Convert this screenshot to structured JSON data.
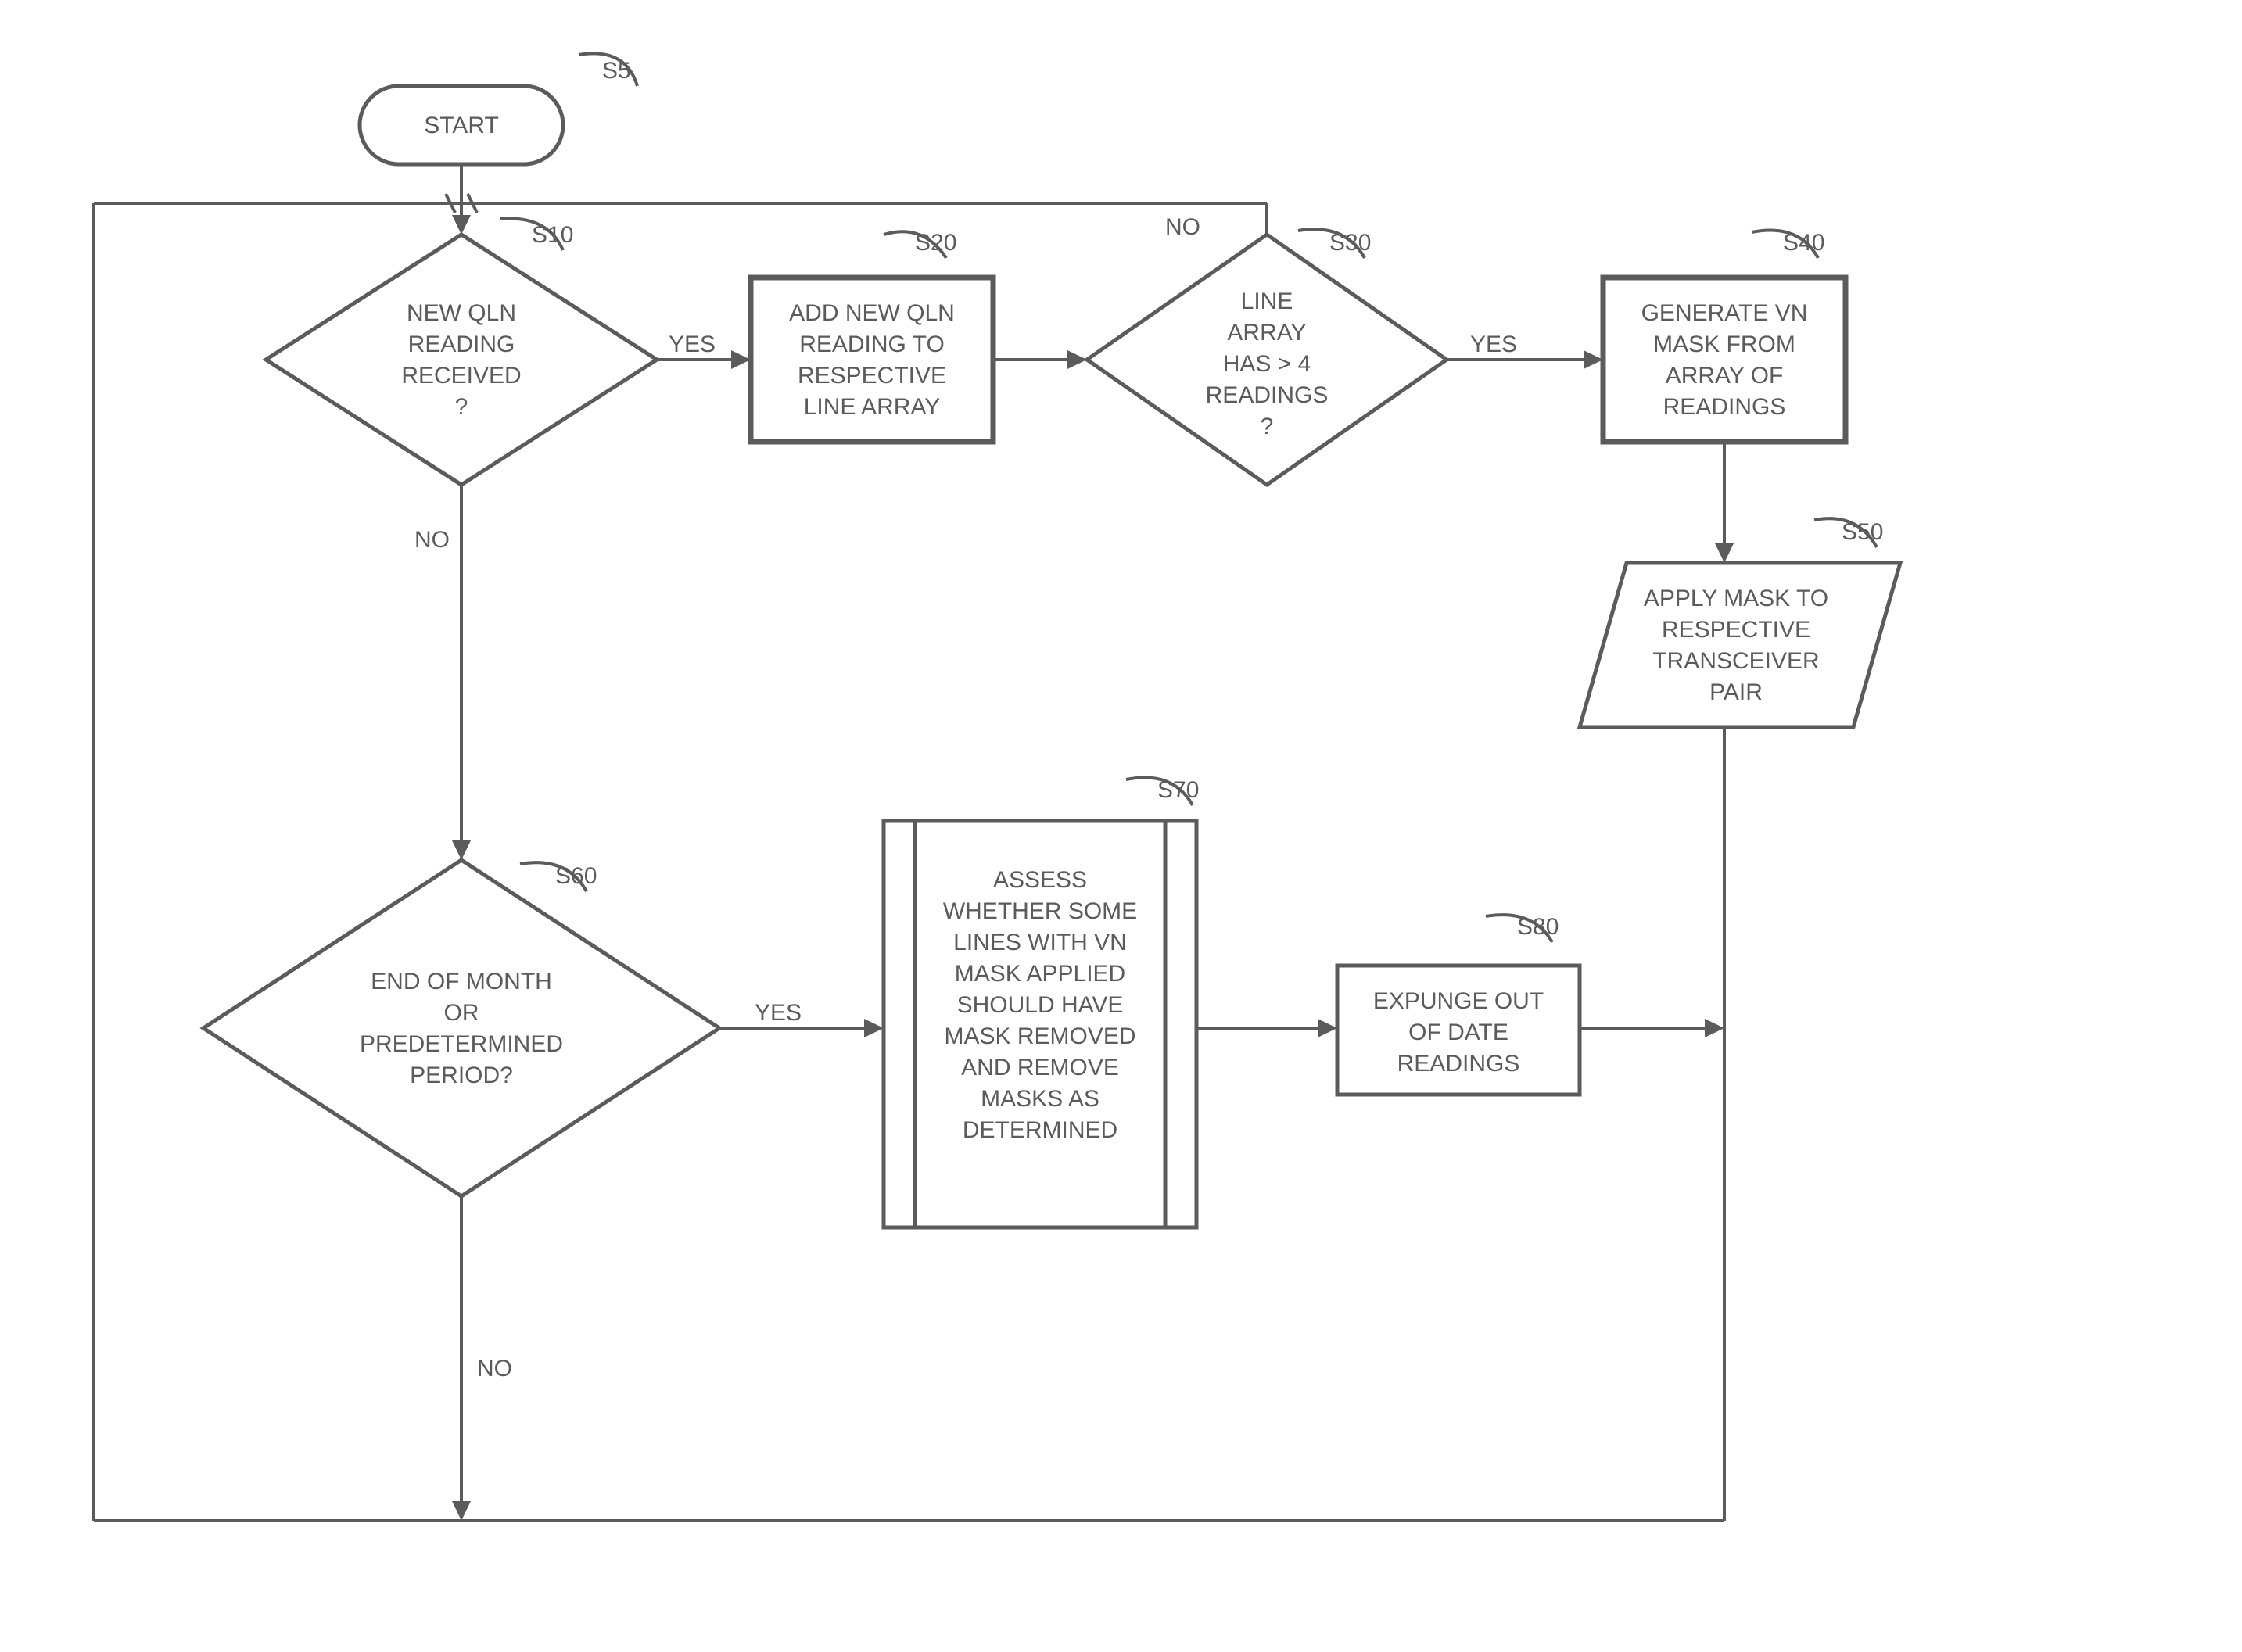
{
  "nodes": {
    "start": {
      "label": "S5",
      "text": [
        "START"
      ]
    },
    "s10": {
      "label": "S10",
      "text": [
        "NEW QLN",
        "READING",
        "RECEIVED",
        "?"
      ]
    },
    "s20": {
      "label": "S20",
      "text": [
        "ADD NEW QLN",
        "READING TO",
        "RESPECTIVE",
        "LINE ARRAY"
      ]
    },
    "s30": {
      "label": "S30",
      "text": [
        "LINE",
        "ARRAY",
        "HAS > 4",
        "READINGS",
        "?"
      ]
    },
    "s40": {
      "label": "S40",
      "text": [
        "GENERATE VN",
        "MASK FROM",
        "ARRAY OF",
        "READINGS"
      ]
    },
    "s50": {
      "label": "S50",
      "text": [
        "APPLY MASK TO",
        "RESPECTIVE",
        "TRANSCEIVER",
        "PAIR"
      ]
    },
    "s60": {
      "label": "S60",
      "text": [
        "END OF MONTH",
        "OR",
        "PREDETERMINED",
        "PERIOD?"
      ]
    },
    "s70": {
      "label": "S70",
      "text": [
        "ASSESS",
        "WHETHER SOME",
        "LINES WITH VN",
        "MASK APPLIED",
        "SHOULD HAVE",
        "MASK REMOVED",
        "AND REMOVE",
        "MASKS AS",
        "DETERMINED"
      ]
    },
    "s80": {
      "label": "S80",
      "text": [
        "EXPUNGE OUT",
        "OF DATE",
        "READINGS"
      ]
    }
  },
  "edges": {
    "yes": "YES",
    "no": "NO"
  },
  "chart_data": {
    "type": "flowchart",
    "nodes": [
      {
        "id": "S5",
        "shape": "terminator",
        "text": "START"
      },
      {
        "id": "S10",
        "shape": "decision",
        "text": "NEW QLN READING RECEIVED ?"
      },
      {
        "id": "S20",
        "shape": "process",
        "text": "ADD NEW QLN READING TO RESPECTIVE LINE ARRAY"
      },
      {
        "id": "S30",
        "shape": "decision",
        "text": "LINE ARRAY HAS > 4 READINGS ?"
      },
      {
        "id": "S40",
        "shape": "process",
        "text": "GENERATE VN MASK FROM ARRAY OF READINGS"
      },
      {
        "id": "S50",
        "shape": "io",
        "text": "APPLY MASK TO RESPECTIVE TRANSCEIVER PAIR"
      },
      {
        "id": "S60",
        "shape": "decision",
        "text": "END OF MONTH OR PREDETERMINED PERIOD?"
      },
      {
        "id": "S70",
        "shape": "subprocess",
        "text": "ASSESS WHETHER SOME LINES WITH VN MASK APPLIED SHOULD HAVE MASK REMOVED AND REMOVE MASKS AS DETERMINED"
      },
      {
        "id": "S80",
        "shape": "process",
        "text": "EXPUNGE OUT OF DATE READINGS"
      }
    ],
    "edges": [
      {
        "from": "S5",
        "to": "S10",
        "label": ""
      },
      {
        "from": "S10",
        "to": "S20",
        "label": "YES"
      },
      {
        "from": "S10",
        "to": "S60",
        "label": "NO"
      },
      {
        "from": "S20",
        "to": "S30",
        "label": ""
      },
      {
        "from": "S30",
        "to": "S40",
        "label": "YES"
      },
      {
        "from": "S30",
        "to": "LOOP_TOP",
        "label": "NO"
      },
      {
        "from": "S40",
        "to": "S50",
        "label": ""
      },
      {
        "from": "S50",
        "to": "LOOP_BOTTOM",
        "label": ""
      },
      {
        "from": "S60",
        "to": "S70",
        "label": "YES"
      },
      {
        "from": "S60",
        "to": "LOOP_BOTTOM",
        "label": "NO"
      },
      {
        "from": "S70",
        "to": "S80",
        "label": ""
      },
      {
        "from": "S80",
        "to": "LOOP_BOTTOM_JOIN",
        "label": ""
      },
      {
        "from": "LOOP_BOTTOM",
        "to": "S10",
        "label": ""
      }
    ]
  }
}
